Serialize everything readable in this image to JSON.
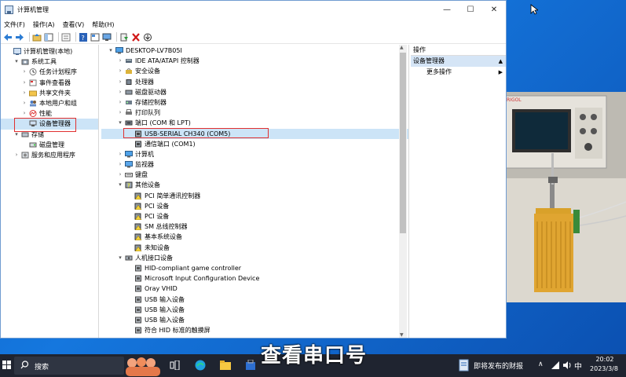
{
  "window": {
    "title": "计算机管理",
    "controls": {
      "min": "—",
      "max": "☐",
      "close": "✕"
    }
  },
  "menu": [
    "文件(F)",
    "操作(A)",
    "查看(V)",
    "帮助(H)"
  ],
  "left_tree": [
    {
      "label": "计算机管理(本地)",
      "level": 0,
      "arrow": "",
      "icon": "computer-management-icon"
    },
    {
      "label": "系统工具",
      "level": 1,
      "arrow": "▾",
      "icon": "tools-icon"
    },
    {
      "label": "任务计划程序",
      "level": 2,
      "arrow": "›",
      "icon": "clock-icon"
    },
    {
      "label": "事件查看器",
      "level": 2,
      "arrow": "›",
      "icon": "event-viewer-icon"
    },
    {
      "label": "共享文件夹",
      "level": 2,
      "arrow": "›",
      "icon": "shared-folder-icon"
    },
    {
      "label": "本地用户和组",
      "level": 2,
      "arrow": "›",
      "icon": "users-icon"
    },
    {
      "label": "性能",
      "level": 2,
      "arrow": "›",
      "icon": "performance-icon"
    },
    {
      "label": "设备管理器",
      "level": 2,
      "arrow": "",
      "icon": "device-manager-icon",
      "selected": true
    },
    {
      "label": "存储",
      "level": 1,
      "arrow": "▾",
      "icon": "storage-icon"
    },
    {
      "label": "磁盘管理",
      "level": 2,
      "arrow": "",
      "icon": "disk-icon"
    },
    {
      "label": "服务和应用程序",
      "level": 1,
      "arrow": "›",
      "icon": "services-icon"
    }
  ],
  "device_tree": [
    {
      "label": "DESKTOP-LV7B05I",
      "level": 0,
      "arrow": "▾",
      "icon": "computer-icon"
    },
    {
      "label": "IDE ATA/ATAPI 控制器",
      "level": 1,
      "arrow": "›",
      "icon": "ide-icon"
    },
    {
      "label": "安全设备",
      "level": 1,
      "arrow": "›",
      "icon": "security-device-icon"
    },
    {
      "label": "处理器",
      "level": 1,
      "arrow": "›",
      "icon": "processor-icon"
    },
    {
      "label": "磁盘驱动器",
      "level": 1,
      "arrow": "›",
      "icon": "disk-drive-icon"
    },
    {
      "label": "存储控制器",
      "level": 1,
      "arrow": "›",
      "icon": "storage-controller-icon"
    },
    {
      "label": "打印队列",
      "level": 1,
      "arrow": "›",
      "icon": "printer-icon"
    },
    {
      "label": "端口 (COM 和 LPT)",
      "level": 1,
      "arrow": "▾",
      "icon": "port-icon"
    },
    {
      "label": "USB-SERIAL CH340 (COM5)",
      "level": 2,
      "arrow": "",
      "icon": "port-device-icon",
      "highlight": true
    },
    {
      "label": "通信端口 (COM1)",
      "level": 2,
      "arrow": "",
      "icon": "port-device-icon"
    },
    {
      "label": "计算机",
      "level": 1,
      "arrow": "›",
      "icon": "computer-icon"
    },
    {
      "label": "监视器",
      "level": 1,
      "arrow": "›",
      "icon": "monitor-icon"
    },
    {
      "label": "键盘",
      "level": 1,
      "arrow": "›",
      "icon": "keyboard-icon"
    },
    {
      "label": "其他设备",
      "level": 1,
      "arrow": "▾",
      "icon": "other-devices-icon"
    },
    {
      "label": "PCI 简单通讯控制器",
      "level": 2,
      "arrow": "",
      "icon": "unknown-device-icon"
    },
    {
      "label": "PCI 设备",
      "level": 2,
      "arrow": "",
      "icon": "unknown-device-icon"
    },
    {
      "label": "PCI 设备",
      "level": 2,
      "arrow": "",
      "icon": "unknown-device-icon"
    },
    {
      "label": "SM 总线控制器",
      "level": 2,
      "arrow": "",
      "icon": "unknown-device-icon"
    },
    {
      "label": "基本系统设备",
      "level": 2,
      "arrow": "",
      "icon": "unknown-device-icon"
    },
    {
      "label": "未知设备",
      "level": 2,
      "arrow": "",
      "icon": "unknown-device-icon"
    },
    {
      "label": "人机接口设备",
      "level": 1,
      "arrow": "▾",
      "icon": "hid-icon"
    },
    {
      "label": "HID-compliant game controller",
      "level": 2,
      "arrow": "",
      "icon": "hid-device-icon"
    },
    {
      "label": "Microsoft Input Configuration Device",
      "level": 2,
      "arrow": "",
      "icon": "hid-device-icon"
    },
    {
      "label": "Oray VHID",
      "level": 2,
      "arrow": "",
      "icon": "hid-device-icon"
    },
    {
      "label": "USB 输入设备",
      "level": 2,
      "arrow": "",
      "icon": "hid-device-icon"
    },
    {
      "label": "USB 输入设备",
      "level": 2,
      "arrow": "",
      "icon": "hid-device-icon"
    },
    {
      "label": "USB 输入设备",
      "level": 2,
      "arrow": "",
      "icon": "hid-device-icon"
    },
    {
      "label": "符合 HID 标准的触摸屏",
      "level": 2,
      "arrow": "",
      "icon": "hid-device-icon"
    }
  ],
  "actions": {
    "header": "操作",
    "selected": "设备管理器",
    "more": "更多操作"
  },
  "caption": "查看串口号",
  "taskbar": {
    "search_label": "搜索",
    "news": "即将发布的财报",
    "ime": "中",
    "time": "20:02",
    "date": "2023/3/8"
  },
  "colors": {
    "selection": "#cce4f7",
    "highlight_box": "#e03030",
    "taskbar": "#1f2430"
  }
}
